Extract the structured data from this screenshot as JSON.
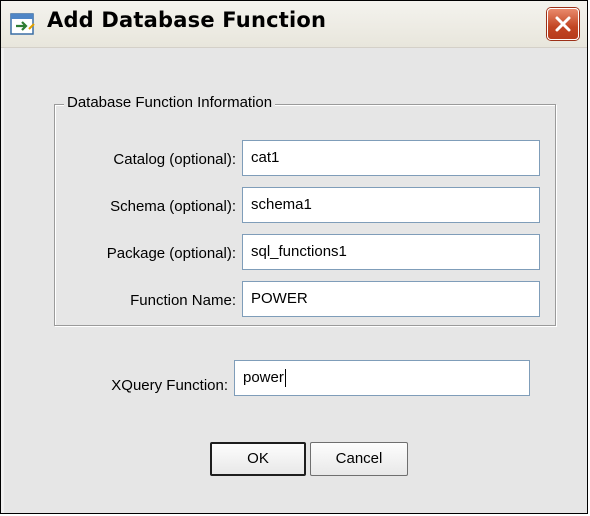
{
  "window": {
    "title": "Add Database Function",
    "icon": "add-function-icon",
    "close_icon": "close-icon"
  },
  "group": {
    "legend": "Database Function Information",
    "fields": [
      {
        "label": "Catalog (optional):",
        "value": "cat1"
      },
      {
        "label": "Schema (optional):",
        "value": "schema1"
      },
      {
        "label": "Package (optional):",
        "value": "sql_functions1"
      },
      {
        "label": "Function Name:",
        "value": "POWER"
      }
    ]
  },
  "xquery": {
    "label": "XQuery Function:",
    "value": "power"
  },
  "buttons": {
    "ok": "OK",
    "cancel": "Cancel"
  },
  "colors": {
    "close_button": "#c24523",
    "field_border": "#7f9db9",
    "background": "#e6e6e6"
  }
}
